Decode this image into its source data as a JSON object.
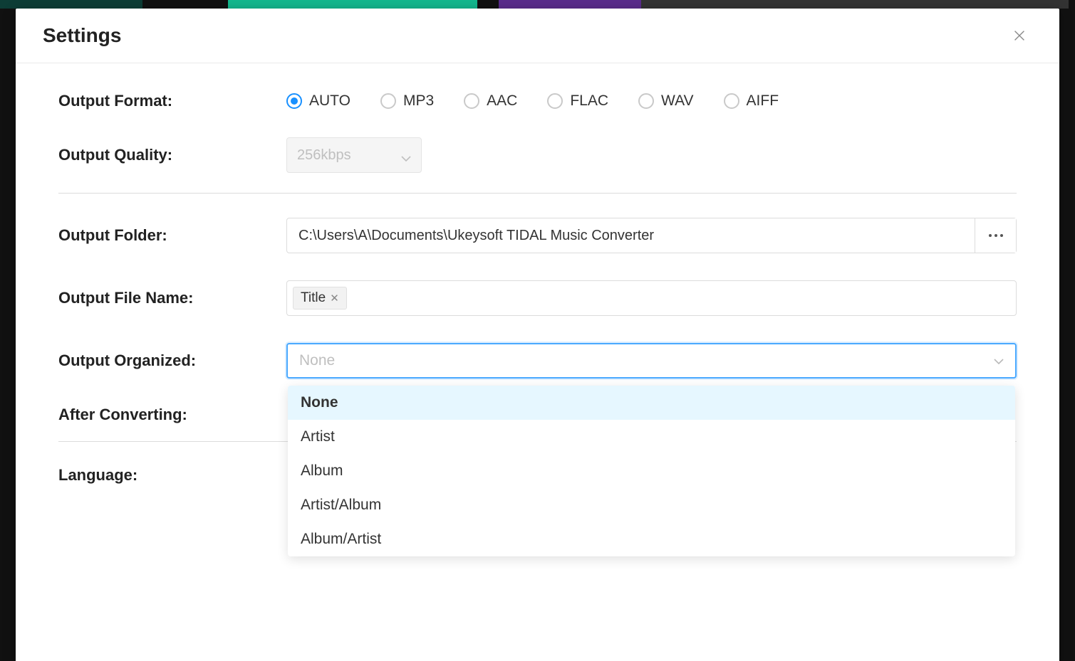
{
  "dialog": {
    "title": "Settings"
  },
  "output_format": {
    "label": "Output Format:",
    "options": [
      "AUTO",
      "MP3",
      "AAC",
      "FLAC",
      "WAV",
      "AIFF"
    ],
    "selected": "AUTO"
  },
  "output_quality": {
    "label": "Output Quality:",
    "value": "256kbps",
    "disabled": true
  },
  "output_folder": {
    "label": "Output Folder:",
    "value": "C:\\Users\\A\\Documents\\Ukeysoft TIDAL Music Converter"
  },
  "output_file_name": {
    "label": "Output File Name:",
    "tags": [
      "Title"
    ]
  },
  "output_organized": {
    "label": "Output Organized:",
    "placeholder": "None",
    "options": [
      "None",
      "Artist",
      "Album",
      "Artist/Album",
      "Album/Artist"
    ],
    "highlighted": "None"
  },
  "after_converting": {
    "label": "After Converting:"
  },
  "language": {
    "label": "Language:"
  }
}
